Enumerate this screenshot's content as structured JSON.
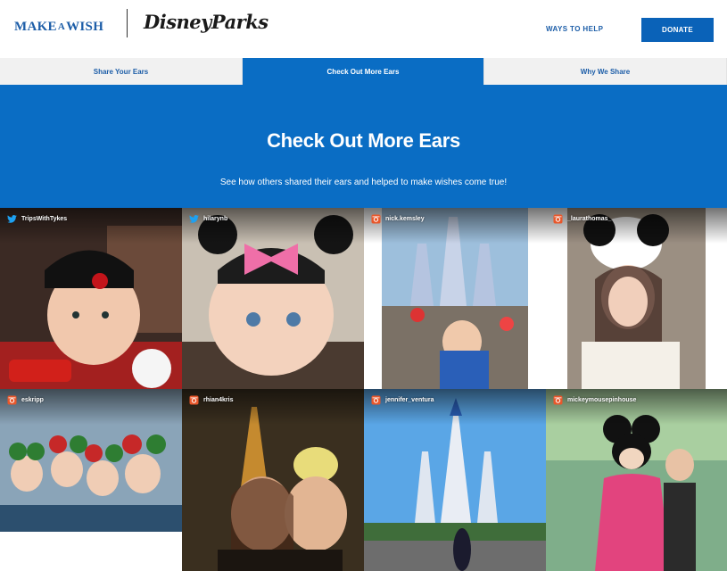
{
  "header": {
    "logo_make_a_wish": {
      "make": "MAKE",
      "a": "A",
      "wish": "WISH"
    },
    "logo_disney_parks": "DisneyParks",
    "ways_to_help": "WAYS TO HELP",
    "donate": "DONATE"
  },
  "tabs": [
    {
      "label": "Share Your Ears"
    },
    {
      "label": "Check Out More Ears",
      "active": true
    },
    {
      "label": "Why We Share"
    }
  ],
  "hero": {
    "title": "Check Out More Ears",
    "subtitle": "See how others shared their ears and helped to make wishes come true!"
  },
  "colors": {
    "brand_blue": "#0a6dc4",
    "donate_blue": "#0a62b8",
    "link_blue": "#1d5ea8",
    "twitter_blue": "#1da1f2",
    "instagram_orange": "#e8572b"
  },
  "posts": [
    {
      "source": "twitter-icon",
      "user": "TripsWithTykes"
    },
    {
      "source": "twitter-icon",
      "user": "hilarynb"
    },
    {
      "source": "instagram-icon",
      "user": "nick.kemsley"
    },
    {
      "source": "instagram-icon",
      "user": "_laurathomas_"
    },
    {
      "source": "instagram-icon",
      "user": "eskripp"
    },
    {
      "source": "instagram-icon",
      "user": "rhian4kris"
    },
    {
      "source": "instagram-icon",
      "user": "jennifer_ventura"
    },
    {
      "source": "instagram-icon",
      "user": "mickeymousepinhouse"
    }
  ]
}
